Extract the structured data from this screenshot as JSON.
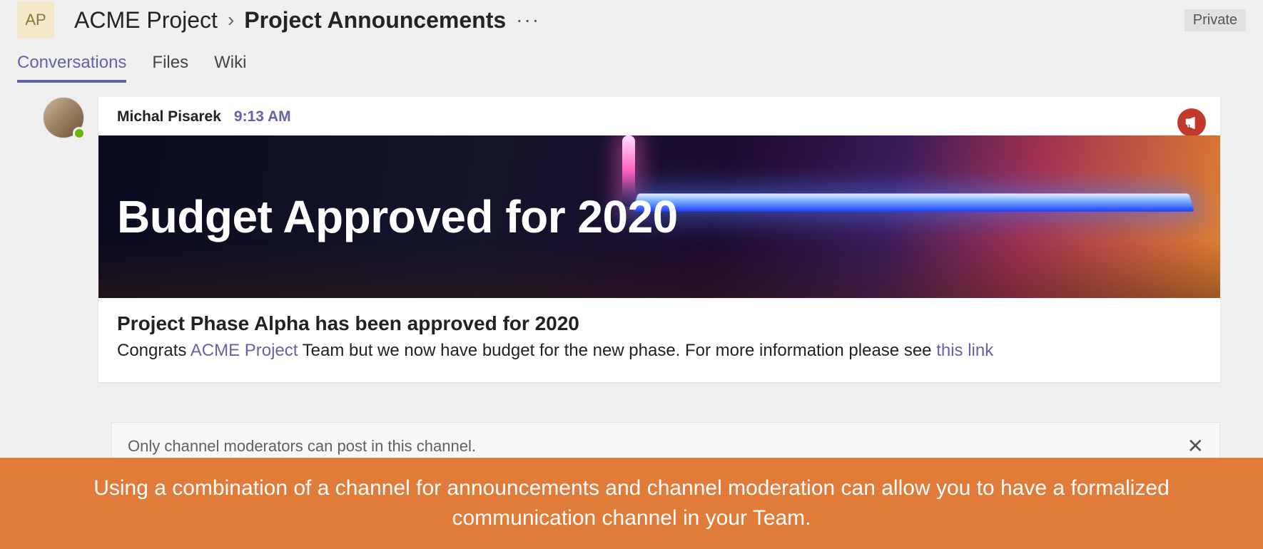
{
  "header": {
    "team_initials": "AP",
    "team_name": "ACME Project",
    "channel_name": "Project Announcements",
    "privacy_label": "Private"
  },
  "tabs": [
    {
      "label": "Conversations",
      "active": true
    },
    {
      "label": "Files",
      "active": false
    },
    {
      "label": "Wiki",
      "active": false
    }
  ],
  "post": {
    "author": "Michal Pisarek",
    "time": "9:13 AM",
    "hero_title": "Budget Approved for 2020",
    "subhead": "Project Phase Alpha has been approved for 2020",
    "body_prefix": "Congrats ",
    "mention": "ACME Project",
    "body_mid": " Team but we now have budget for the new phase. For more information please see ",
    "link_text": "this link"
  },
  "compose": {
    "restriction_text": "Only channel moderators can post in this channel."
  },
  "caption": {
    "text": "Using a combination of a channel for announcements and channel moderation can allow you to have a formalized communication channel in your Team."
  }
}
